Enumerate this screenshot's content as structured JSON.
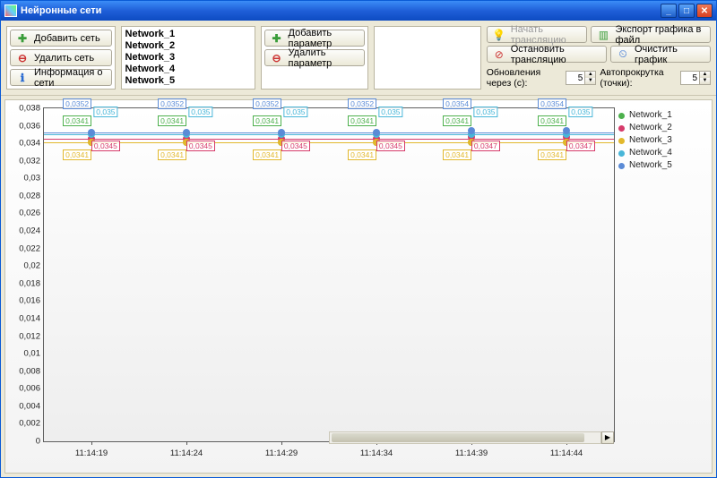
{
  "window": {
    "title": "Нейронные сети"
  },
  "toolbar": {
    "add_net": "Добавить сеть",
    "del_net": "Удалить сеть",
    "net_info": "Информация о сети",
    "add_param": "Добавить параметр",
    "del_param": "Удалить параметр",
    "start_broadcast": "Начать трансляцию",
    "stop_broadcast": "Остановить трансляцию",
    "export": "Экспорт графика в файл",
    "clear": "Очистить график",
    "update_label": "Обновления через (с):",
    "update_val": "5",
    "autoscroll_label": "Автопрокрутка (точки):",
    "autoscroll_val": "5"
  },
  "networks": [
    "Network_1",
    "Network_2",
    "Network_3",
    "Network_4",
    "Network_5"
  ],
  "legend": [
    {
      "name": "Network_1",
      "color": "#4cb04c"
    },
    {
      "name": "Network_2",
      "color": "#d63a6a"
    },
    {
      "name": "Network_3",
      "color": "#e2b82c"
    },
    {
      "name": "Network_4",
      "color": "#48b6d8"
    },
    {
      "name": "Network_5",
      "color": "#5b8bd6"
    }
  ],
  "chart_data": {
    "type": "line",
    "xlabel": "",
    "ylabel": "",
    "ylim": [
      0,
      0.038
    ],
    "yticks": [
      0,
      0.002,
      0.004,
      0.006,
      0.008,
      0.01,
      0.012,
      0.014,
      0.016,
      0.018,
      0.02,
      0.022,
      0.024,
      0.026,
      0.028,
      0.03,
      0.032,
      0.034,
      0.036,
      0.038
    ],
    "ytick_labels": [
      "0",
      "0,002",
      "0,004",
      "0,006",
      "0,008",
      "0,01",
      "0,012",
      "0,014",
      "0,016",
      "0,018",
      "0,02",
      "0,022",
      "0,024",
      "0,026",
      "0,028",
      "0,03",
      "0,032",
      "0,034",
      "0,036",
      "0,038"
    ],
    "categories": [
      "11:14:19",
      "11:14:24",
      "11:14:29",
      "11:14:34",
      "11:14:39",
      "11:14:44"
    ],
    "series": [
      {
        "name": "Network_1",
        "color": "#4cb04c",
        "values": [
          0.0341,
          0.0341,
          0.0341,
          0.0341,
          0.0341,
          0.0341
        ]
      },
      {
        "name": "Network_2",
        "color": "#d63a6a",
        "values": [
          0.0345,
          0.0345,
          0.0345,
          0.0345,
          0.0347,
          0.0347
        ]
      },
      {
        "name": "Network_3",
        "color": "#e2b82c",
        "values": [
          0.0341,
          0.0341,
          0.0341,
          0.0341,
          0.0341,
          0.0341
        ]
      },
      {
        "name": "Network_4",
        "color": "#48b6d8",
        "values": [
          0.035,
          0.035,
          0.035,
          0.035,
          0.035,
          0.035
        ]
      },
      {
        "name": "Network_5",
        "color": "#5b8bd6",
        "values": [
          0.0352,
          0.0352,
          0.0352,
          0.0352,
          0.0354,
          0.0354
        ]
      }
    ],
    "point_labels": [
      {
        "series": "Network_5",
        "vals": [
          "0,0352",
          "0,0352",
          "0,0352",
          "0,0352",
          "0,0354",
          "0,0354"
        ]
      },
      {
        "series": "Network_4",
        "vals": [
          "0,035",
          "0,035",
          "0,035",
          "0,035",
          "0,035",
          "0,035"
        ]
      },
      {
        "series": "Network_1",
        "vals": [
          "0,0341",
          "0,0341",
          "0,0341",
          "0,0341",
          "0,0341",
          "0,0341"
        ]
      },
      {
        "series": "Network_2",
        "vals": [
          "0,0345",
          "0,0345",
          "0,0345",
          "0,0345",
          "0,0347",
          "0,0347"
        ]
      },
      {
        "series": "Network_3",
        "vals": [
          "0,0341",
          "0,0341",
          "0,0341",
          "0,0341",
          "0,0341",
          "0,0341"
        ]
      }
    ]
  }
}
